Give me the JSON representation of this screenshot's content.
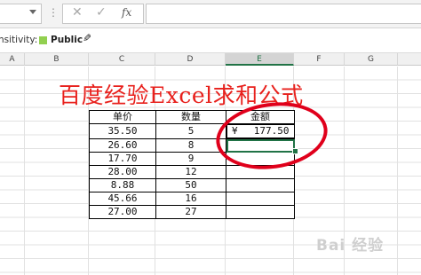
{
  "formula_bar": {
    "fx_label": "fx",
    "cancel_label": "✕",
    "enter_label": "✓",
    "separator": "⋮",
    "formula_value": ""
  },
  "sensitivity": {
    "label": "nsitivity:",
    "value": "Public",
    "swatch_color": "#92d050"
  },
  "columns": [
    "A",
    "B",
    "C",
    "D",
    "E",
    "F",
    "G"
  ],
  "selected_column": "E",
  "title": "百度经验Excel求和公式",
  "table": {
    "headers": [
      "单价",
      "数量",
      "金额"
    ],
    "rows": [
      {
        "price": "35.50",
        "qty": "5",
        "amount_symbol": "¥",
        "amount": "177.50"
      },
      {
        "price": "26.60",
        "qty": "8",
        "amount_symbol": "",
        "amount": ""
      },
      {
        "price": "17.70",
        "qty": "9",
        "amount_symbol": "",
        "amount": ""
      },
      {
        "price": "28.00",
        "qty": "12",
        "amount_symbol": "",
        "amount": ""
      },
      {
        "price": "8.88",
        "qty": "50",
        "amount_symbol": "",
        "amount": ""
      },
      {
        "price": "45.66",
        "qty": "16",
        "amount_symbol": "",
        "amount": ""
      },
      {
        "price": "27.00",
        "qty": "27",
        "amount_symbol": "",
        "amount": ""
      }
    ]
  },
  "watermark": "Bai 经验",
  "colors": {
    "title_red": "#e8201c",
    "selection_green": "#217346",
    "annotation_red": "#e0001b"
  }
}
